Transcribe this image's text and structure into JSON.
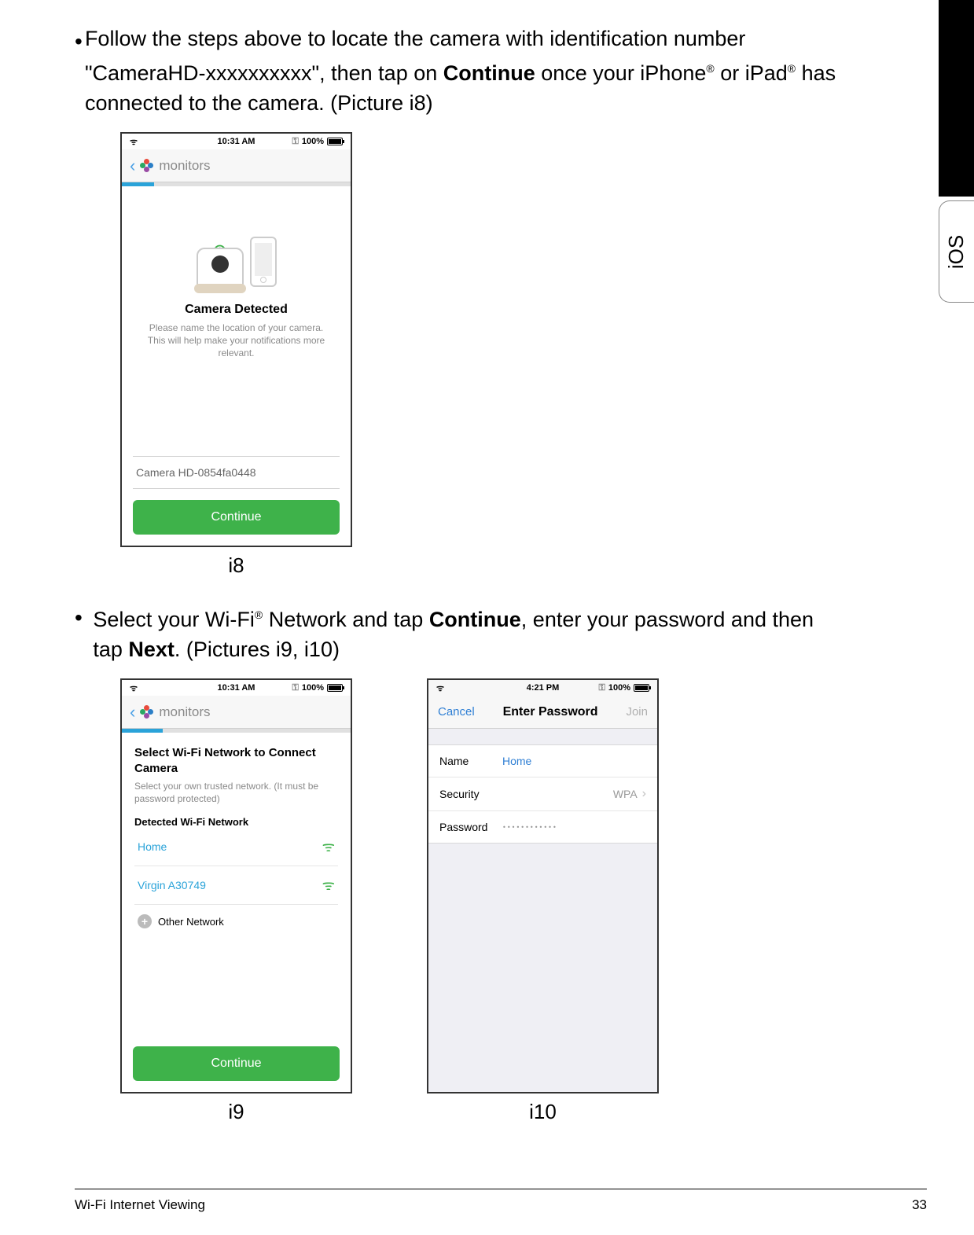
{
  "side_tab": "iOS",
  "bullet1": {
    "pre": "Follow the steps above to locate the camera with identification number \"CameraHD-xxxxxxxxxx\", then tap on ",
    "bold1": "Continue",
    "post1": " once your iPhone",
    "reg1": "®",
    "post2": " or iPad",
    "reg2": "®",
    "post3": " has connected to the camera. (Picture i8)"
  },
  "bullet2": {
    "pre": "Select your Wi-Fi",
    "reg1": "®",
    "mid1": " Network and tap ",
    "bold1": "Continue",
    "mid2": ", enter your password and then tap ",
    "bold2": "Next",
    "post": ". (Pictures i9, i10)"
  },
  "statusbar": {
    "time1": "10:31 AM",
    "time2": "10:31 AM",
    "time3": "4:21 PM",
    "batt": "100%"
  },
  "screen_i8": {
    "header": "monitors",
    "title": "Camera Detected",
    "sub": "Please name the location of your camera. This will help make your notifications more relevant.",
    "input": "Camera HD-0854fa0448",
    "button": "Continue",
    "caption": "i8"
  },
  "screen_i9": {
    "header": "monitors",
    "title": "Select Wi-Fi Network to Connect Camera",
    "sub": "Select your own trusted network. (It must be password protected)",
    "detected": "Detected Wi-Fi Network",
    "net1": "Home",
    "net2": "Virgin A30749",
    "other": "Other Network",
    "button": "Continue",
    "caption": "i9"
  },
  "screen_i10": {
    "cancel": "Cancel",
    "title": "Enter Password",
    "join": "Join",
    "name_label": "Name",
    "name_value": "Home",
    "security_label": "Security",
    "security_value": "WPA",
    "password_label": "Password",
    "password_value": "••••••••••••",
    "caption": "i10"
  },
  "footer": {
    "left": "Wi-Fi Internet Viewing",
    "right": "33"
  }
}
